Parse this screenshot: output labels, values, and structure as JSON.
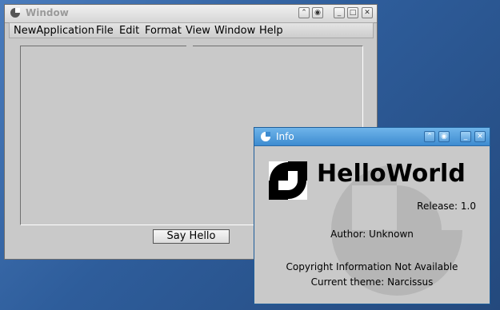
{
  "main_window": {
    "title": "Window",
    "menu": [
      "NewApplication",
      "File",
      "Edit",
      "Format",
      "View",
      "Window",
      "Help"
    ],
    "say_hello_label": "Say Hello",
    "title_buttons": [
      "⌃",
      "◉",
      "_",
      "□",
      "✕"
    ]
  },
  "info_window": {
    "title": "Info",
    "app_name": "HelloWorld",
    "release": "Release: 1.0",
    "author": "Author: Unknown",
    "copyright": "Copyright Information Not Available",
    "theme": "Current theme: Narcissus",
    "title_buttons": [
      "⌃",
      "◉",
      "_",
      "✕"
    ]
  },
  "colors": {
    "desktop": "#2e5d9b",
    "window_bg": "#c9c9c9",
    "info_titlebar": "#4a97d8"
  }
}
